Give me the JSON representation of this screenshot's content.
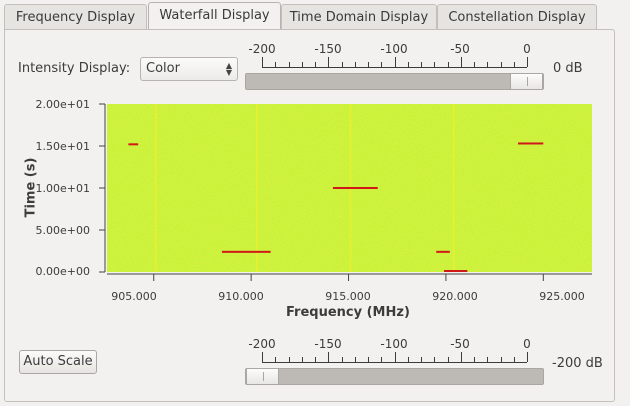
{
  "tabs": [
    {
      "label": "Frequency Display",
      "active": false
    },
    {
      "label": "Waterfall Display",
      "active": true
    },
    {
      "label": "Time Domain Display",
      "active": false
    },
    {
      "label": "Constellation Display",
      "active": false
    }
  ],
  "intensity": {
    "label": "Intensity Display:",
    "value": "Color"
  },
  "top_scale": {
    "ticks": [
      "-200",
      "-150",
      "-100",
      "-50",
      "0"
    ],
    "readout": "0 dB",
    "value_db": 0
  },
  "bottom_scale": {
    "ticks": [
      "-200",
      "-150",
      "-100",
      "-50",
      "0"
    ],
    "readout": "-200 dB",
    "value_db": -200
  },
  "auto_scale_label": "Auto Scale",
  "chart_data": {
    "type": "heatmap",
    "xlabel": "Frequency (MHz)",
    "ylabel": "Time (s)",
    "x_ticks": [
      "905.000",
      "910.000",
      "915.000",
      "920.000",
      "925.000"
    ],
    "x_tick_values": [
      905,
      910,
      915,
      920,
      925
    ],
    "y_ticks": [
      "2.00e+01",
      "1.50e+01",
      "1.00e+01",
      "5.00e+00",
      "0.00e+00"
    ],
    "y_tick_values": [
      20,
      15,
      10,
      5,
      0
    ],
    "xlim": [
      902.6,
      927.5
    ],
    "ylim": [
      0,
      20
    ],
    "colormap": [
      "#7df24f",
      "#c8f23a",
      "#f4f02a",
      "#f0a020",
      "#d01818"
    ],
    "vertical_lines_mhz": [
      905.1,
      910.3,
      915.1,
      920.4
    ],
    "bursts": [
      {
        "f_start": 903.7,
        "f_end": 904.2,
        "t": 15.2
      },
      {
        "f_start": 914.2,
        "f_end": 916.5,
        "t": 10.0
      },
      {
        "f_start": 923.7,
        "f_end": 925.0,
        "t": 15.3
      },
      {
        "f_start": 908.5,
        "f_end": 911.0,
        "t": 2.4
      },
      {
        "f_start": 919.5,
        "f_end": 920.2,
        "t": 2.4
      },
      {
        "f_start": 919.9,
        "f_end": 921.1,
        "t": 0.0
      }
    ]
  }
}
